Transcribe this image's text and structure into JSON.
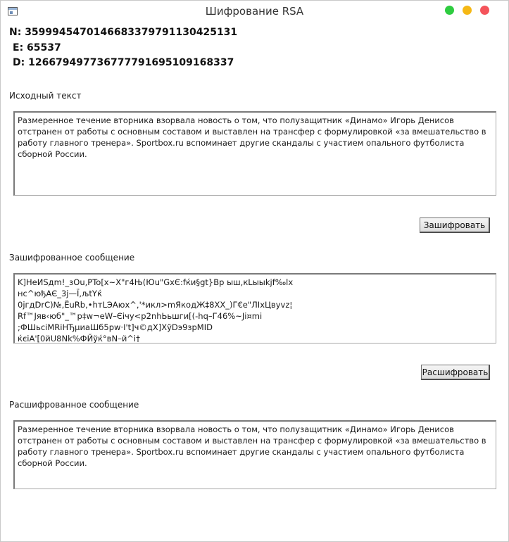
{
  "window": {
    "title": "Шифрование RSA",
    "controls": {
      "green": "#2ecc40",
      "yellow": "#f5b815",
      "red": "#f4545b"
    }
  },
  "keys": {
    "n": "N:  35999454701466833797911304251​31",
    "e": "E: 65537",
    "d": "D: 12667949773677779169510916833​7"
  },
  "source": {
    "label": "Исходный текст",
    "text": "Размеренное течение вторника взорвала новость о том, что полузащитник «Динамо» Игорь Денисов отстранен от работы с основным составом и выставлен на трансфер с формулировкой «за вмешательство в работу главного тренера». Sportbox.ru вспоминает другие скандалы с участием опального футболиста сборной России."
  },
  "encrypt_button": "Зашифровать",
  "encrypted": {
    "label": "Зашифрованное сообщение",
    "lines": [
      "K]НеИSдm!_зОu,PTo[x~X\"г4Њ(Юu\"GxЄ:fќи§gt}Вр ыш,кLыыkjf‰lx",
      "нс^юђАЄ_3j—Ї,љtYќ",
      "0jгдDrC)№,ЁuRb,•hтLЭАюх^,'*икл>mЯкодЖ‡8ХХ_)Г€е\"ЛIхЦвуvz¦",
      "Rf™Јяв‹юб\"_™р‡w¬eW–Єічу<р2nhЬьшги[(-hq–Г46%~Ji¤mi",
      ";ФШьсiMRiНЂµиаШб5рw·I't]ч©дХ]ХўDэ9зрMID",
      "ќєiА'[0йU8Nk%ФЙўќ°вN–й^i†"
    ]
  },
  "decrypt_button": "Расшифровать",
  "decrypted": {
    "label": "Расшифрованное сообщение",
    "text": "Размеренное течение вторника взорвала новость о том, что полузащитник «Динамо» Игорь Денисов отстранен от работы с основным составом и выставлен на трансфер с формулировкой «за вмешательство в работу главного тренера». Sportbox.ru вспоминает другие скандалы с участием опального футболиста сборной России."
  }
}
